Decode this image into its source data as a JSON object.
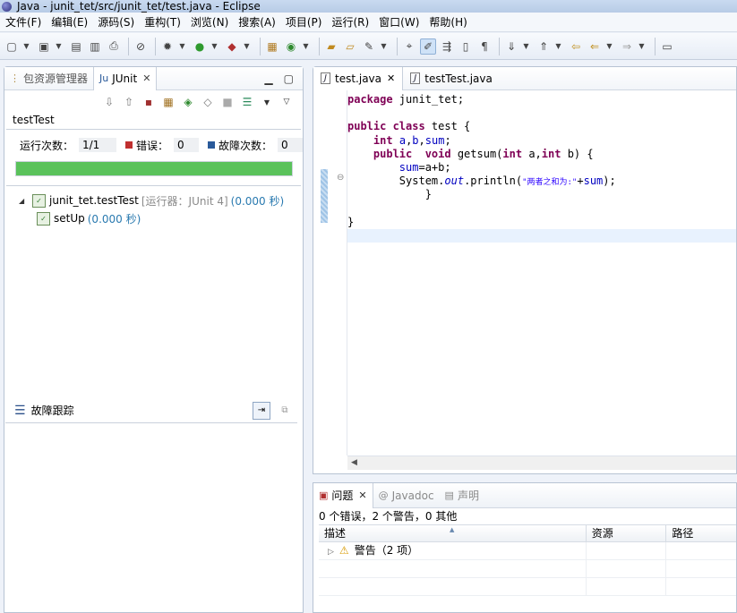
{
  "window": {
    "title": "Java - junit_tet/src/junit_tet/test.java - Eclipse"
  },
  "menu": [
    "文件(F)",
    "编辑(E)",
    "源码(S)",
    "重构(T)",
    "浏览(N)",
    "搜索(A)",
    "项目(P)",
    "运行(R)",
    "窗口(W)",
    "帮助(H)"
  ],
  "left_tabs": {
    "package_explorer": "包资源管理器",
    "junit": "JUnit"
  },
  "junit": {
    "test_name": "testTest",
    "runs_label": "运行次数：",
    "runs_value": "1/1",
    "errors_label": "错误：",
    "errors_value": "0",
    "failures_label": "故障次数：",
    "failures_value": "0",
    "progress": 1.0,
    "progress_color": "#5ac25b",
    "tree": [
      {
        "name": "junit_tet.testTest",
        "runner": "[运行器：JUnit 4]",
        "time": "(0.000 秒)"
      },
      {
        "name": "setUp",
        "time": "(0.000 秒)"
      }
    ],
    "failure_trace_label": "故障跟踪"
  },
  "editor": {
    "tabs": [
      "test.java",
      "testTest.java"
    ],
    "code_lines": [
      "package junit_tet;",
      "",
      "public class test {",
      "    int a,b,sum;",
      "    public  void getsum(int a,int b) {",
      "        sum=a+b;",
      "        System.out.println(\"两者之和为:\"+sum);",
      "            }",
      "",
      "}",
      ""
    ]
  },
  "bottom": {
    "tabs": [
      "问题",
      "Javadoc",
      "声明"
    ],
    "summary": "0 个错误，2 个警告，0 其他",
    "columns": [
      "描述",
      "资源",
      "路径"
    ],
    "rows": [
      "警告（2 项）"
    ]
  }
}
